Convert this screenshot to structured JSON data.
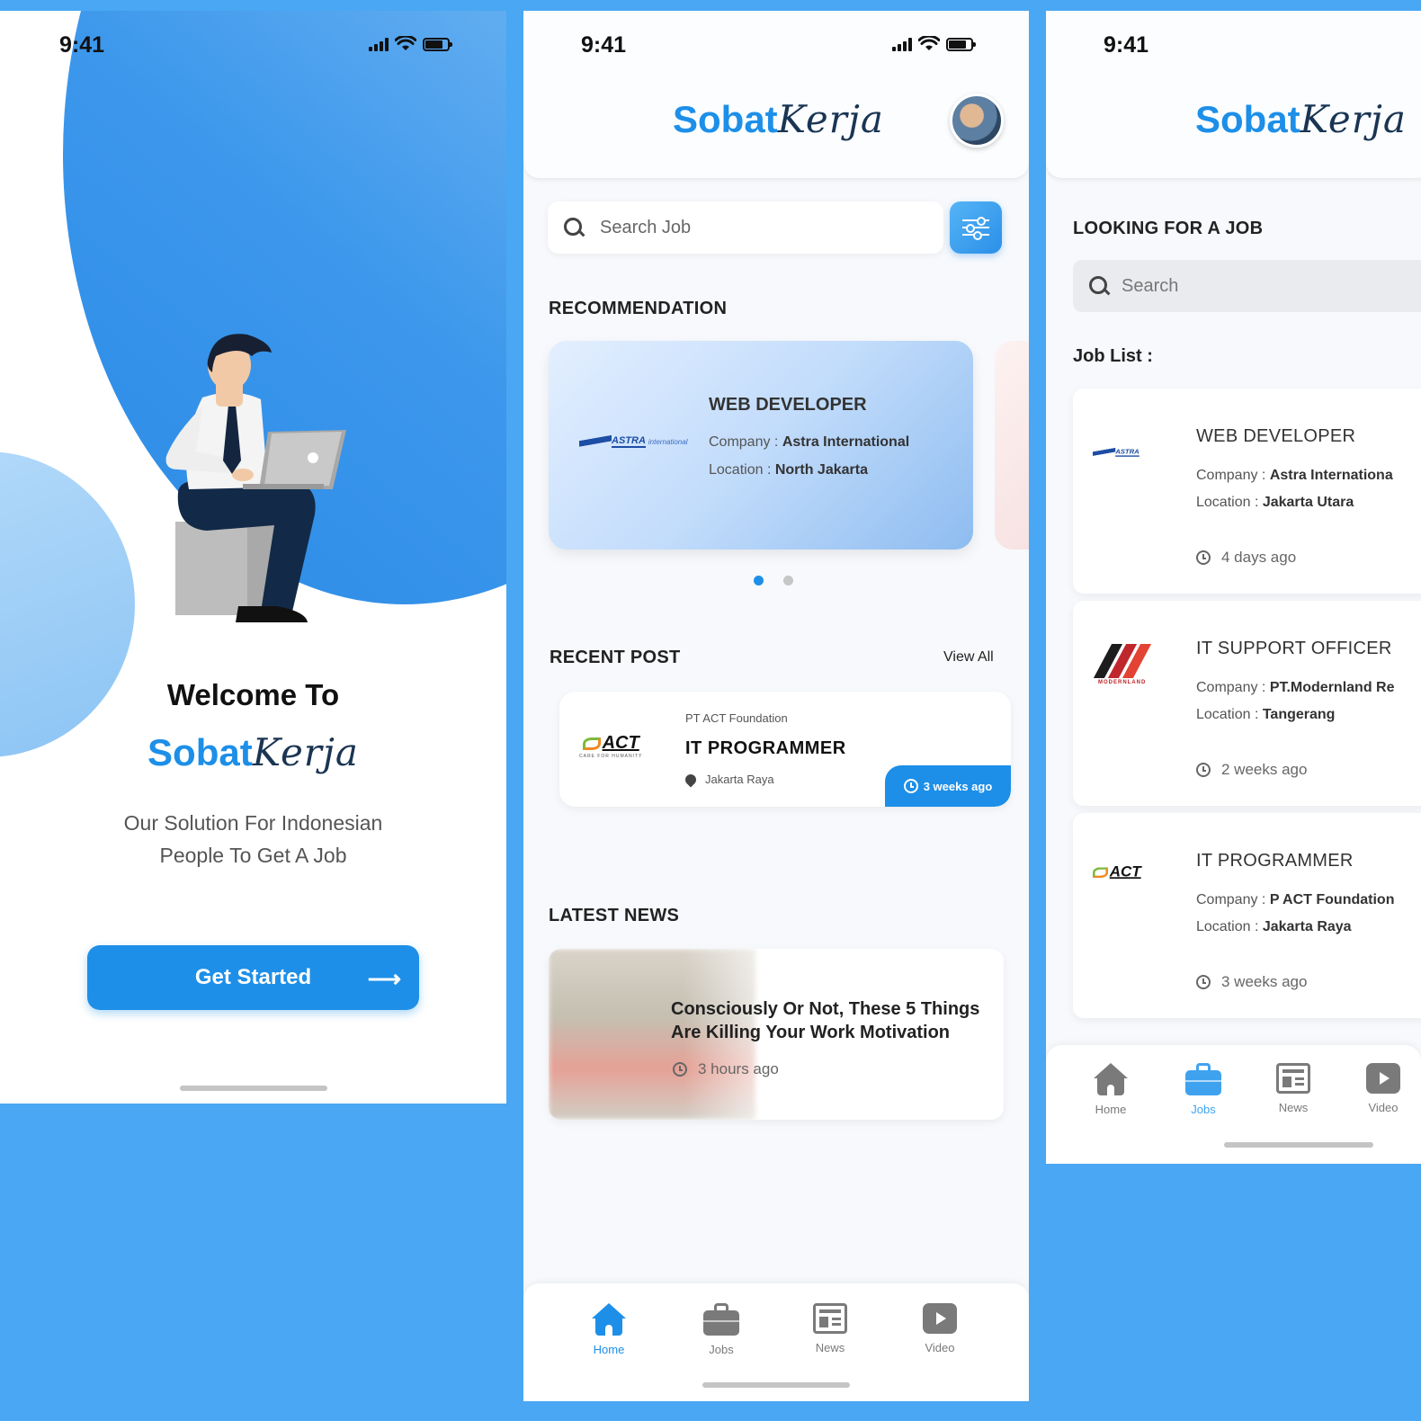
{
  "colors": {
    "background": "#49a7f3",
    "accent": "#1d8fe8",
    "logo_dark": "#1a3553"
  },
  "status_bar": {
    "time": "9:41"
  },
  "brand": {
    "part1": "Sobat",
    "part2": "Kerja"
  },
  "welcome_screen": {
    "welcome": "Welcome To",
    "tagline_line1": "Our Solution For Indonesian",
    "tagline_line2": "People To Get A Job",
    "cta": "Get Started",
    "cta_arrow": "⟶"
  },
  "home_screen": {
    "search_placeholder": "Search Job",
    "recommendation_title": "RECOMMENDATION",
    "recommendation": {
      "title": "WEB DEVELOPER",
      "company_label": "Company : ",
      "company": "Astra International",
      "location_label": "Location : ",
      "location": "North Jakarta",
      "logo_text": "ASTRA",
      "logo_sub": "international"
    },
    "carousel": {
      "pages": 2,
      "active": 1
    },
    "recent_title": "RECENT POST",
    "view_all": "View All",
    "recent": {
      "company": "PT ACT Foundation",
      "title": "IT PROGRAMMER",
      "location": "Jakarta Raya",
      "time": "3 weeks ago",
      "logo_text": "ACT",
      "logo_tag": "CARE FOR HUMANITY"
    },
    "news_title": "LATEST NEWS",
    "news": {
      "headline": "Consciously Or Not, These 5 Things Are Killing Your Work Motivation",
      "time": "3 hours ago"
    }
  },
  "tabs": [
    {
      "label": "Home",
      "icon": "home-icon"
    },
    {
      "label": "Jobs",
      "icon": "briefcase-icon"
    },
    {
      "label": "News",
      "icon": "newspaper-icon"
    },
    {
      "label": "Video",
      "icon": "play-icon"
    }
  ],
  "jobs_screen": {
    "heading": "LOOKING FOR A JOB",
    "search_placeholder": "Search",
    "list_label": "Job List :",
    "company_label": "Company : ",
    "location_label": "Location : ",
    "jobs": [
      {
        "title": "WEB DEVELOPER",
        "company": "Astra Internationa",
        "location": "Jakarta Utara",
        "time": "4 days ago",
        "logo": "ASTRA"
      },
      {
        "title": "IT SUPPORT OFFICER",
        "company": "PT.Modernland Re",
        "location": "Tangerang",
        "time": "2 weeks ago",
        "logo": "MODERNLAND"
      },
      {
        "title": "IT PROGRAMMER",
        "company": "P ACT Foundation",
        "location": "Jakarta Raya",
        "time": "3 weeks ago",
        "logo": "ACT"
      }
    ]
  }
}
